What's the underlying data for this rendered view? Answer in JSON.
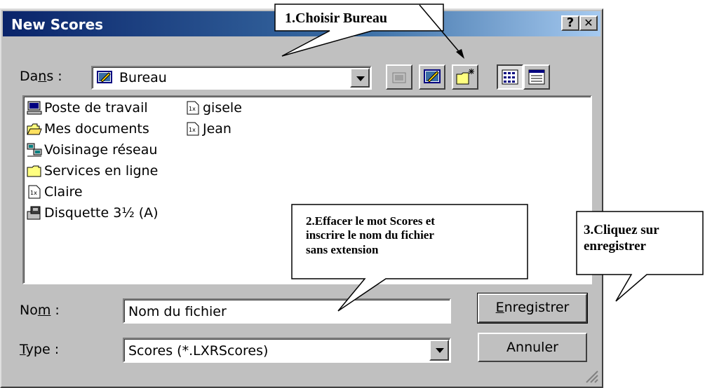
{
  "dialog": {
    "title": "New Scores",
    "help_button": "?",
    "close_button": "✕",
    "look_in_label": "Dans :",
    "look_in_value": "Bureau",
    "name_label": "Nom :",
    "name_value": "Nom du fichier",
    "type_label": "Type :",
    "type_value": "Scores (*.LXRScores)",
    "save_button": "Enregistrer",
    "cancel_button": "Annuler"
  },
  "files": [
    {
      "name": "Poste de travail",
      "icon": "computer-icon"
    },
    {
      "name": "Mes documents",
      "icon": "folder-open-icon"
    },
    {
      "name": "Voisinage réseau",
      "icon": "network-icon"
    },
    {
      "name": "Services en ligne",
      "icon": "folder-icon"
    },
    {
      "name": "Claire",
      "icon": "score-file-icon"
    },
    {
      "name": "Disquette 3½ (A)",
      "icon": "floppy-icon"
    },
    {
      "name": "gisele",
      "icon": "score-file-icon"
    },
    {
      "name": "Jean",
      "icon": "score-file-icon"
    }
  ],
  "callouts": {
    "c1": "1.Choisir Bureau",
    "c2_line1": "2.Effacer  le mot Scores et",
    "c2_line2": "inscrire le nom du fichier",
    "c2_line3": "sans extension",
    "c3_line1": "3.Cliquez sur",
    "c3_line2": "enregistrer"
  },
  "colors": {
    "titlebar_start": "#0a246a",
    "titlebar_end": "#a6caf0",
    "dialog_face": "#c0c0c0"
  }
}
